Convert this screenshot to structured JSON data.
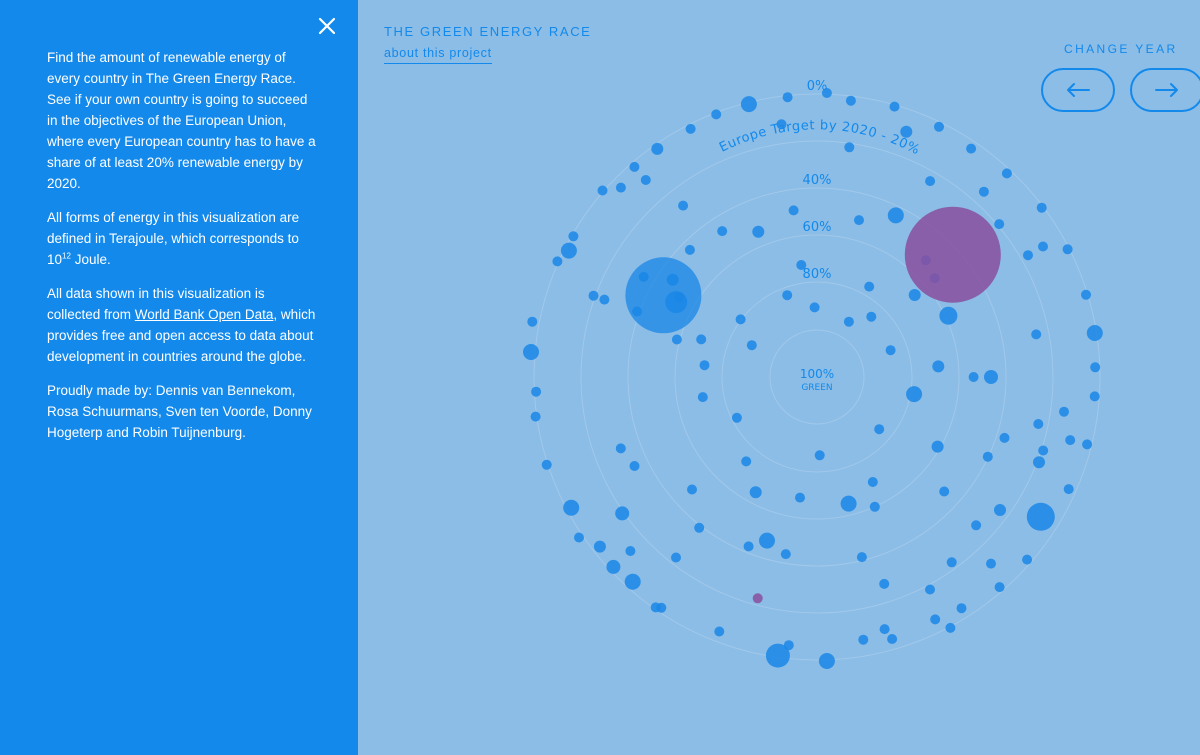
{
  "header": {
    "title": "THE GREEN ENERGY RACE",
    "about_link": "about this project",
    "change_year_label": "CHANGE YEAR"
  },
  "info_panel": {
    "paragraph1": "Find the amount of renewable energy of every country in The Green Energy Race. See if your own country is going to succeed in the objectives of the European Union, where every European country has to have a share of at least 20% renewable energy by 2020.",
    "paragraph2_before": "All forms of energy in this visualization are defined in Terajoule, which corresponds to 10",
    "paragraph2_sup": "12",
    "paragraph2_after": " Joule.",
    "paragraph3_before": "All data shown in this visualization is collected from ",
    "paragraph3_link": "World Bank Open Data",
    "paragraph3_after": ", which provides free and open access to data about development in countries around the globe.",
    "paragraph4": "Proudly made by: Dennis van Bennekom, Rosa Schuurmans, Sven ten Voorde, Donny Hogeterp and Robin Tuijnenburg."
  },
  "icons": {
    "close": "close-icon",
    "prev": "arrow-left-icon",
    "next": "arrow-right-icon"
  },
  "colors": {
    "panel_bg": "#1389ec",
    "page_bg": "#8bbde6",
    "bubble": "#1a87e6",
    "highlight": "#8a4f9e"
  },
  "chart_data": {
    "type": "scatter",
    "ring_labels": [
      "0%",
      "40%",
      "60%",
      "80%",
      "100%"
    ],
    "center_sub_label": "GREEN",
    "target_label": "Europe Target by 2020 - 20%",
    "bubbles": [
      {
        "d": 0.98,
        "a": 88,
        "s": 8
      },
      {
        "d": 0.93,
        "a": 96,
        "s": 5
      },
      {
        "d": 0.92,
        "a": 80,
        "s": 5
      },
      {
        "d": 0.97,
        "a": 98,
        "s": 12
      },
      {
        "d": 0.94,
        "a": 111,
        "s": 5
      },
      {
        "d": 0.96,
        "a": 124,
        "s": 5
      },
      {
        "d": 0.97,
        "a": 125,
        "s": 5
      },
      {
        "d": 0.95,
        "a": 132,
        "s": 8
      },
      {
        "d": 0.88,
        "a": 137,
        "s": 5
      },
      {
        "d": 0.96,
        "a": 137,
        "s": 7
      },
      {
        "d": 0.95,
        "a": 142,
        "s": 6
      },
      {
        "d": 0.99,
        "a": 146,
        "s": 5
      },
      {
        "d": 0.96,
        "a": 152,
        "s": 8
      },
      {
        "d": 0.98,
        "a": 162,
        "s": 5
      },
      {
        "d": 0.98,
        "a": 172,
        "s": 5
      },
      {
        "d": 0.97,
        "a": 177,
        "s": 5
      },
      {
        "d": 0.99,
        "a": 185,
        "s": 8
      },
      {
        "d": 1.0,
        "a": 191,
        "s": 5
      },
      {
        "d": 0.98,
        "a": 204,
        "s": 5
      },
      {
        "d": 0.96,
        "a": 207,
        "s": 8
      },
      {
        "d": 0.97,
        "a": 210,
        "s": 5
      },
      {
        "d": 0.98,
        "a": 221,
        "s": 5
      },
      {
        "d": 0.96,
        "a": 229,
        "s": 5
      },
      {
        "d": 0.96,
        "a": 235,
        "s": 6
      },
      {
        "d": 0.96,
        "a": 243,
        "s": 5
      },
      {
        "d": 0.97,
        "a": 249,
        "s": 5
      },
      {
        "d": 0.97,
        "a": 256,
        "s": 8
      },
      {
        "d": 0.97,
        "a": 264,
        "s": 5
      },
      {
        "d": 0.98,
        "a": 272,
        "s": 5
      },
      {
        "d": 0.96,
        "a": 277,
        "s": 5
      },
      {
        "d": 0.97,
        "a": 286,
        "s": 5
      },
      {
        "d": 0.96,
        "a": 296,
        "s": 5
      },
      {
        "d": 0.95,
        "a": 304,
        "s": 5
      },
      {
        "d": 0.96,
        "a": 313,
        "s": 5
      },
      {
        "d": 0.97,
        "a": 323,
        "s": 5
      },
      {
        "d": 0.97,
        "a": 333,
        "s": 5
      },
      {
        "d": 0.97,
        "a": 343,
        "s": 5
      },
      {
        "d": 0.97,
        "a": 351,
        "s": 8
      },
      {
        "d": 0.96,
        "a": 358,
        "s": 5
      },
      {
        "d": 0.96,
        "a": 4,
        "s": 5
      },
      {
        "d": 0.96,
        "a": 14,
        "s": 5
      },
      {
        "d": 0.95,
        "a": 24,
        "s": 5
      },
      {
        "d": 0.91,
        "a": 32,
        "s": 14
      },
      {
        "d": 0.96,
        "a": 41,
        "s": 5
      },
      {
        "d": 0.96,
        "a": 49,
        "s": 5
      },
      {
        "d": 0.94,
        "a": 58,
        "s": 5
      },
      {
        "d": 0.93,
        "a": 64,
        "s": 5
      },
      {
        "d": 0.94,
        "a": 74,
        "s": 5
      },
      {
        "d": 0.82,
        "a": 21,
        "s": 6
      },
      {
        "d": 0.78,
        "a": 36,
        "s": 6
      },
      {
        "d": 0.79,
        "a": 54,
        "s": 5
      },
      {
        "d": 0.83,
        "a": 62,
        "s": 5
      },
      {
        "d": 0.75,
        "a": 72,
        "s": 5
      },
      {
        "d": 0.79,
        "a": 128,
        "s": 5
      },
      {
        "d": 0.82,
        "a": 145,
        "s": 7
      },
      {
        "d": 0.72,
        "a": 160,
        "s": 5
      },
      {
        "d": 0.82,
        "a": 200,
        "s": 5
      },
      {
        "d": 0.75,
        "a": 232,
        "s": 5
      },
      {
        "d": 0.8,
        "a": 278,
        "s": 5
      },
      {
        "d": 0.78,
        "a": 300,
        "s": 5
      },
      {
        "d": 0.82,
        "a": 320,
        "s": 5
      },
      {
        "d": 0.77,
        "a": 349,
        "s": 5
      },
      {
        "d": 0.78,
        "a": 12,
        "s": 5
      },
      {
        "d": 0.75,
        "a": 43,
        "s": 5
      },
      {
        "d": 0.64,
        "a": 76,
        "s": 5
      },
      {
        "d": 0.63,
        "a": 112,
        "s": 5
      },
      {
        "d": 0.59,
        "a": 107,
        "s": 8
      },
      {
        "d": 0.58,
        "a": 138,
        "s": 5
      },
      {
        "d": 0.55,
        "a": 210,
        "s": 5
      },
      {
        "d": 0.6,
        "a": 237,
        "s": 5
      },
      {
        "d": 0.58,
        "a": 262,
        "s": 5
      },
      {
        "d": 0.62,
        "a": 296,
        "s": 8
      },
      {
        "d": 0.55,
        "a": 313,
        "s": 5
      },
      {
        "d": 0.65,
        "a": 25,
        "s": 5
      },
      {
        "d": 0.59,
        "a": 42,
        "s": 5
      },
      {
        "d": 0.54,
        "a": 0,
        "s": 5
      },
      {
        "d": 0.42,
        "a": 98,
        "s": 5
      },
      {
        "d": 0.49,
        "a": 66,
        "s": 5
      },
      {
        "d": 0.41,
        "a": 62,
        "s": 5
      },
      {
        "d": 0.38,
        "a": 130,
        "s": 5
      },
      {
        "d": 0.31,
        "a": 153,
        "s": 5
      },
      {
        "d": 0.42,
        "a": 198,
        "s": 5
      },
      {
        "d": 0.33,
        "a": 217,
        "s": 5
      },
      {
        "d": 0.3,
        "a": 250,
        "s": 5
      },
      {
        "d": 0.39,
        "a": 262,
        "s": 5
      },
      {
        "d": 0.36,
        "a": 300,
        "s": 5
      },
      {
        "d": 0.28,
        "a": 312,
        "s": 5
      },
      {
        "d": 0.28,
        "a": 40,
        "s": 5
      },
      {
        "d": 0.34,
        "a": 10,
        "s": 8
      },
      {
        "d": 0.42,
        "a": 355,
        "s": 6
      },
      {
        "d": 0.27,
        "a": 88,
        "s": 5
      },
      {
        "d": 0.45,
        "a": 76,
        "s": 8
      },
      {
        "d": 0.45,
        "a": 118,
        "s": 6
      },
      {
        "d": 0.68,
        "a": 18,
        "s": 5
      },
      {
        "d": 0.5,
        "a": 335,
        "s": 9
      },
      {
        "d": 0.44,
        "a": 320,
        "s": 6
      },
      {
        "d": 0.56,
        "a": 285,
        "s": 5
      },
      {
        "d": 0.54,
        "a": 248,
        "s": 6
      },
      {
        "d": 0.62,
        "a": 225,
        "s": 5
      },
      {
        "d": 0.66,
        "a": 200,
        "s": 5
      },
      {
        "d": 0.9,
        "a": 229,
        "s": 5
      },
      {
        "d": 0.94,
        "a": 224,
        "s": 5
      },
      {
        "d": 0.88,
        "a": 262,
        "s": 5
      },
      {
        "d": 0.9,
        "a": 290,
        "s": 6
      },
      {
        "d": 0.86,
        "a": 312,
        "s": 5
      },
      {
        "d": 0.84,
        "a": 330,
        "s": 5
      },
      {
        "d": 0.86,
        "a": 8,
        "s": 5
      },
      {
        "d": 0.88,
        "a": 47,
        "s": 5
      },
      {
        "d": 0.69,
        "a": 210,
        "s": 5
      },
      {
        "d": 0.6,
        "a": 214,
        "s": 6
      },
      {
        "d": 0.53,
        "a": 320,
        "s": 5
      },
      {
        "d": 0.24,
        "a": 268,
        "s": 5
      },
      {
        "d": 0.22,
        "a": 300,
        "s": 5
      },
      {
        "d": 0.25,
        "a": 206,
        "s": 5
      },
      {
        "d": 0.27,
        "a": 340,
        "s": 5
      },
      {
        "d": 0.6,
        "a": 0,
        "s": 7
      },
      {
        "d": 0.39,
        "a": 186,
        "s": 5
      },
      {
        "d": 0.4,
        "a": 170,
        "s": 5
      },
      {
        "d": 0.48,
        "a": 30,
        "s": 6
      },
      {
        "d": 0.7,
        "a": 154,
        "s": 5
      },
      {
        "d": 0.66,
        "a": 128,
        "s": 5
      },
      {
        "d": 0.98,
        "a": 62,
        "s": 5
      },
      {
        "d": 0.6,
        "a": 208,
        "s": 38
      },
      {
        "d": 0.55,
        "a": 208,
        "s": 11
      },
      {
        "d": 0.5,
        "a": 195,
        "s": 5
      },
      {
        "d": 0.9,
        "a": 14,
        "s": 5
      },
      {
        "d": 0.9,
        "a": 330,
        "s": 5
      },
      {
        "d": 0.9,
        "a": 75,
        "s": 5
      },
      {
        "d": 0.78,
        "a": 200,
        "s": 5
      },
      {
        "d": 0.82,
        "a": 18,
        "s": 5
      },
      {
        "d": 0.62,
        "a": 100,
        "s": 5
      }
    ],
    "highlighted": [
      {
        "d": 0.79,
        "a": 105,
        "s": 5
      },
      {
        "d": 0.63,
        "a": 318,
        "s": 48
      }
    ]
  }
}
